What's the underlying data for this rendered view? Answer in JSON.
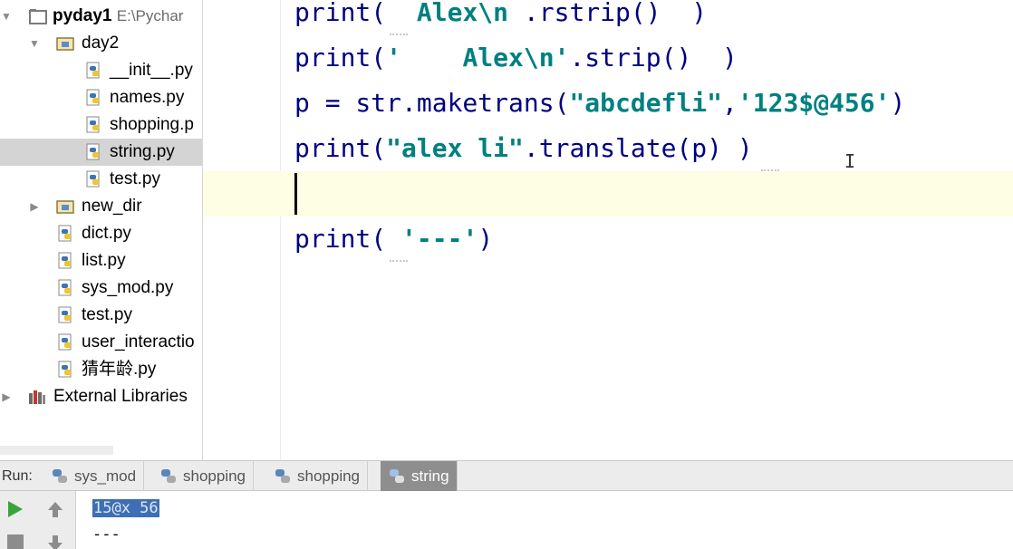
{
  "project_tree": {
    "root": {
      "name": "pyday1",
      "path": "E:\\Pychar"
    },
    "day2": {
      "name": "day2",
      "files": [
        "__init__.py",
        "names.py",
        "shopping.p",
        "string.py",
        "test.py"
      ]
    },
    "new_dir": "new_dir",
    "root_files": [
      "dict.py",
      "list.py",
      "sys_mod.py",
      "test.py",
      "user_interactio",
      "猜年龄.py"
    ],
    "external": "External Libraries",
    "selected": "string.py"
  },
  "editor": {
    "lines": [
      {
        "pre": "print(",
        "str": "  Alex\\n ",
        "post": ".rstrip()  )"
      },
      {
        "pre": "print(",
        "str": "'    Alex\\n'",
        "post": ".strip()  )"
      },
      {
        "pre": "p = str.maketrans(",
        "str": "\"abcdefli\"",
        "mid": ",",
        "str2": "'123$@456'",
        "post": ")"
      },
      {
        "pre": "print(",
        "str": "\"alex li\"",
        "post": ".translate(p) )"
      },
      {
        "pre": "",
        "str": "",
        "post": ""
      },
      {
        "pre": "print( ",
        "str": "'---'",
        "post": ")"
      }
    ]
  },
  "run": {
    "label": "Run:",
    "tabs": [
      "sys_mod",
      "shopping",
      "shopping",
      "string"
    ],
    "active_tab": "string",
    "output": [
      "15@x 56",
      "---"
    ]
  },
  "colors": {
    "accent_tab": "#8e8e8e",
    "selection": "#3e6fb4",
    "current_line": "#fefee4",
    "string": "#008080",
    "keyword": "#000080"
  }
}
